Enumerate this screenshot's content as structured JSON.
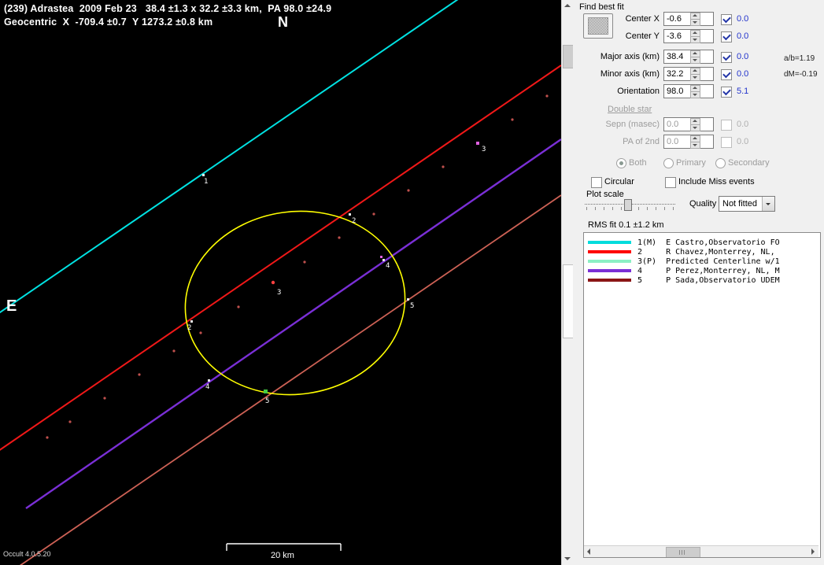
{
  "plot": {
    "title_line1": "(239) Adrastea  2009 Feb 23   38.4 ±1.3 x 32.2 ±3.3 km,  PA 98.0 ±24.9",
    "title_line2": "Geocentric  X  -709.4 ±0.7  Y 1273.2 ±0.8 km",
    "north": "N",
    "east": "E",
    "scale_label": "20 km",
    "version": "Occult 4.0.5.20",
    "colors": {
      "chord1": "#00e2e2",
      "chord2": "#f01818",
      "chord3_dots": "#c0504d",
      "chord4": "#7a2fd6",
      "chord5": "#cd6155",
      "ellipse": "#ffff00"
    },
    "chord_labels": [
      "1",
      "2",
      "2",
      "3",
      "3",
      "4",
      "4",
      "5",
      "5"
    ]
  },
  "panel": {
    "title": "Find best fit",
    "fit_fields": [
      {
        "label": "Center X",
        "value": "-0.6",
        "stat": "0.0"
      },
      {
        "label": "Center Y",
        "value": "-3.6",
        "stat": "0.0"
      },
      {
        "label": "Major axis (km)",
        "value": "38.4",
        "stat": "0.0"
      },
      {
        "label": "Minor axis (km)",
        "value": "32.2",
        "stat": "0.0"
      },
      {
        "label": "Orientation",
        "value": "98.0",
        "stat": "5.1"
      }
    ],
    "ratio_text": "a/b=1.19",
    "dm_text": "dM=-0.19",
    "double_star": {
      "title": "Double star",
      "sepn_label": "Sepn (masec)",
      "sepn_value": "0.0",
      "sepn_stat": "0.0",
      "pa_label": "PA of 2nd",
      "pa_value": "0.0",
      "pa_stat": "0.0",
      "radio_both": "Both",
      "radio_primary": "Primary",
      "radio_secondary": "Secondary"
    },
    "circular_label": "Circular",
    "include_miss_label": "Include Miss events",
    "plot_scale_label": "Plot scale",
    "quality_label": "Quality",
    "quality_value": "Not fitted",
    "rms_label": "RMS fit 0.1 ±1.2 km",
    "legend": [
      {
        "color": "#00dcdc",
        "text": "1(M)  E Castro,Observatorio FO"
      },
      {
        "color": "#ff0000",
        "text": "2     R Chavez,Monterrey, NL,"
      },
      {
        "color": "#8cf0c4",
        "text": "3(P)  Predicted Centerline w/1"
      },
      {
        "color": "#7a2fd6",
        "text": "4     P Perez,Monterrey, NL, M"
      },
      {
        "color": "#8b1616",
        "text": "5     P Sada,Observatorio UDEM"
      }
    ]
  }
}
